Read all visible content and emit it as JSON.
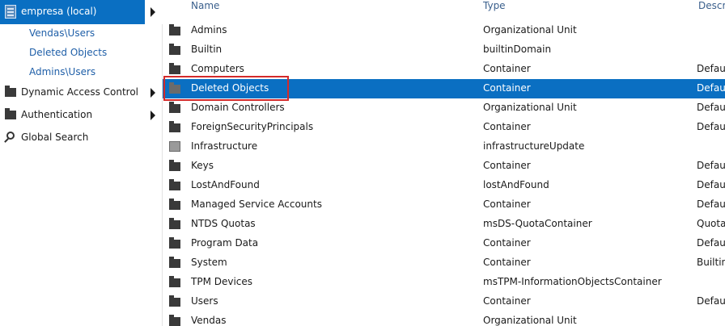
{
  "sidebar": {
    "domain_label": "empresa (local)",
    "links": [
      "Vendas\\Users",
      "Deleted Objects",
      "Admins\\Users"
    ],
    "items": [
      {
        "label": "Dynamic Access Control",
        "icon": "folder-icon",
        "has_submenu": true
      },
      {
        "label": "Authentication",
        "icon": "folder-icon",
        "has_submenu": true
      },
      {
        "label": "Global Search",
        "icon": "search-icon",
        "has_submenu": false
      }
    ]
  },
  "columns": {
    "name": "Name",
    "type": "Type",
    "description": "Descri"
  },
  "rows": [
    {
      "name": "Admins",
      "type": "Organizational Unit",
      "desc": "",
      "icon": "folder-icon"
    },
    {
      "name": "Builtin",
      "type": "builtinDomain",
      "desc": "",
      "icon": "folder-icon"
    },
    {
      "name": "Computers",
      "type": "Container",
      "desc": "Defaul",
      "icon": "folder-icon"
    },
    {
      "name": "Deleted Objects",
      "type": "Container",
      "desc": "Defaul",
      "icon": "folder-icon",
      "selected": true
    },
    {
      "name": "Domain Controllers",
      "type": "Organizational Unit",
      "desc": "Defaul",
      "icon": "folder-icon"
    },
    {
      "name": "ForeignSecurityPrincipals",
      "type": "Container",
      "desc": "Defaul",
      "icon": "folder-icon"
    },
    {
      "name": "Infrastructure",
      "type": "infrastructureUpdate",
      "desc": "",
      "icon": "infrastructure-icon"
    },
    {
      "name": "Keys",
      "type": "Container",
      "desc": "Defaul",
      "icon": "folder-icon"
    },
    {
      "name": "LostAndFound",
      "type": "lostAndFound",
      "desc": "Defaul",
      "icon": "folder-icon"
    },
    {
      "name": "Managed Service Accounts",
      "type": "Container",
      "desc": "Defaul",
      "icon": "folder-icon"
    },
    {
      "name": "NTDS Quotas",
      "type": "msDS-QuotaContainer",
      "desc": "Quota",
      "icon": "folder-icon"
    },
    {
      "name": "Program Data",
      "type": "Container",
      "desc": "Defaul",
      "icon": "folder-icon"
    },
    {
      "name": "System",
      "type": "Container",
      "desc": "Builtin",
      "icon": "folder-icon"
    },
    {
      "name": "TPM Devices",
      "type": "msTPM-InformationObjectsContainer",
      "desc": "",
      "icon": "folder-icon"
    },
    {
      "name": "Users",
      "type": "Container",
      "desc": "Defaul",
      "icon": "folder-icon"
    },
    {
      "name": "Vendas",
      "type": "Organizational Unit",
      "desc": "",
      "icon": "folder-icon"
    }
  ],
  "colors": {
    "selection": "#0a6fc2",
    "link": "#1f5fa8",
    "highlight_border": "#d42a2a"
  }
}
